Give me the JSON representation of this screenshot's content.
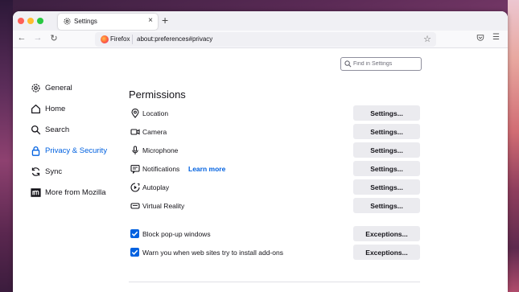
{
  "window": {
    "tab_title": "Settings",
    "new_tab": "+",
    "close_tab": "×"
  },
  "navbar": {
    "identity": "Firefox",
    "url": "about:preferences#privacy"
  },
  "search": {
    "placeholder": "Find in Settings"
  },
  "sidebar": {
    "items": [
      {
        "label": "General",
        "icon": "gear-icon",
        "active": false
      },
      {
        "label": "Home",
        "icon": "home-icon",
        "active": false
      },
      {
        "label": "Search",
        "icon": "search-icon",
        "active": false
      },
      {
        "label": "Privacy & Security",
        "icon": "lock-icon",
        "active": true
      },
      {
        "label": "Sync",
        "icon": "sync-icon",
        "active": false
      },
      {
        "label": "More from Mozilla",
        "icon": "mozilla-icon",
        "active": false
      }
    ]
  },
  "permissions": {
    "title": "Permissions",
    "rows": [
      {
        "label": "Location",
        "icon": "location-icon",
        "button": "Settings..."
      },
      {
        "label": "Camera",
        "icon": "camera-icon",
        "button": "Settings..."
      },
      {
        "label": "Microphone",
        "icon": "microphone-icon",
        "button": "Settings..."
      },
      {
        "label": "Notifications",
        "icon": "notification-icon",
        "button": "Settings...",
        "link": "Learn more"
      },
      {
        "label": "Autoplay",
        "icon": "autoplay-icon",
        "button": "Settings..."
      },
      {
        "label": "Virtual Reality",
        "icon": "vr-icon",
        "button": "Settings..."
      }
    ],
    "checks": [
      {
        "label": "Block pop-up windows",
        "checked": true,
        "button": "Exceptions..."
      },
      {
        "label": "Warn you when web sites try to install add-ons",
        "checked": true,
        "button": "Exceptions..."
      }
    ]
  },
  "colors": {
    "accent": "#0061e0",
    "button_bg": "#ebebef"
  }
}
